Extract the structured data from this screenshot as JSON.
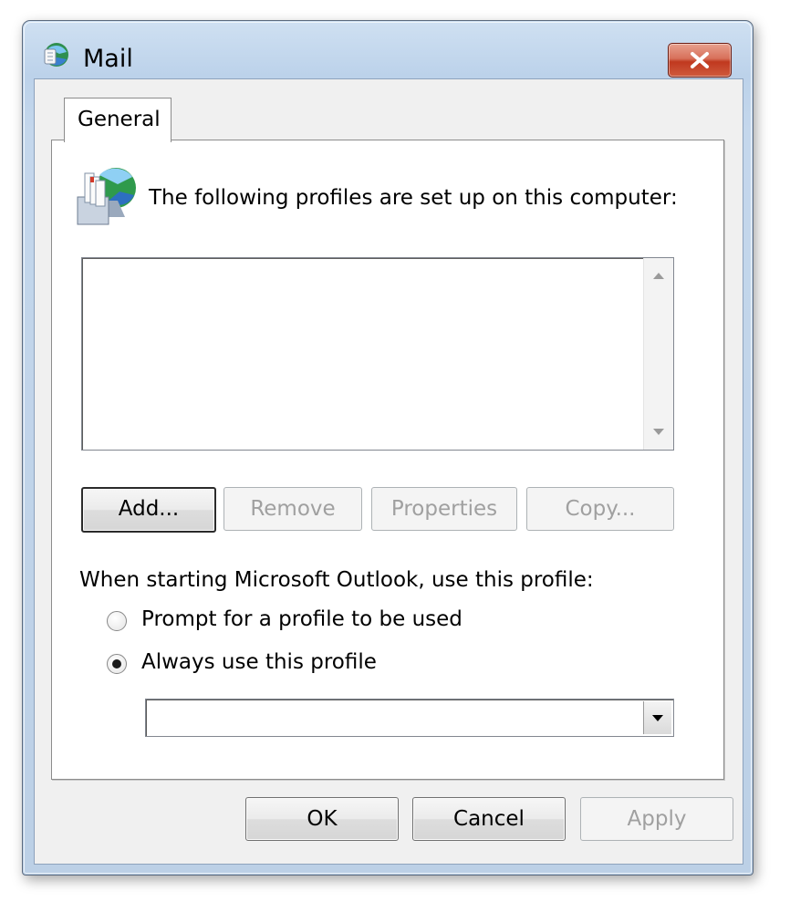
{
  "window": {
    "title": "Mail",
    "close_label": "close"
  },
  "tabs": [
    {
      "label": "General"
    }
  ],
  "panel": {
    "heading": "The following profiles are set up on this computer:",
    "profiles": [],
    "buttons": {
      "add": "Add...",
      "remove": "Remove",
      "properties": "Properties",
      "copy": "Copy..."
    },
    "startup_label": "When starting Microsoft Outlook, use this profile:",
    "radio_prompt": "Prompt for a profile to be used",
    "radio_always": "Always use this profile",
    "selected_radio": "always",
    "profile_select_value": ""
  },
  "footer": {
    "ok": "OK",
    "cancel": "Cancel",
    "apply": "Apply"
  },
  "colors": {
    "close_button": "#c0391f",
    "window_frame": "#bcd2ea",
    "disabled_text": "#a0a0a0"
  }
}
